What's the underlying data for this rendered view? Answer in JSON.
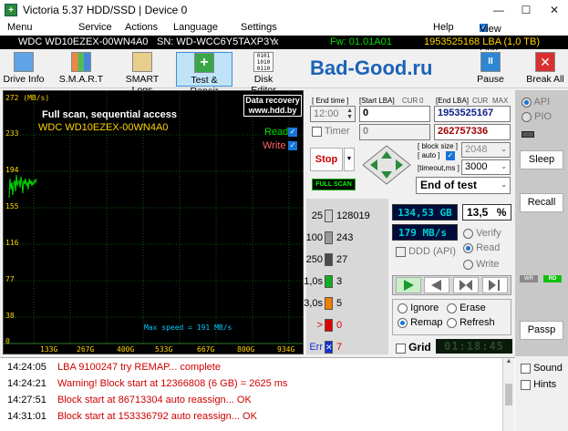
{
  "window": {
    "title": "Victoria 5.37 HDD/SSD | Device 0"
  },
  "menu": [
    "Menu",
    "Service",
    "Actions",
    "Language",
    "Settings",
    "Help",
    "View Buffer Live"
  ],
  "device_bar": {
    "model": "WDC WD10EZEX-00WN4A0",
    "serial": "SN: WD-WCC6Y5TAXP3Y",
    "close": "x",
    "fw": "Fw: 01.01A01",
    "lba": "1953525168 LBA (1,0 TB)"
  },
  "toolbar": {
    "items": [
      "Drive Info",
      "S.M.A.R.T",
      "SMART Logs",
      "Test & Repair",
      "Disk Editor"
    ],
    "brand": "Bad-Good.ru",
    "pause": "Pause",
    "break": "Break All"
  },
  "graph": {
    "ylabel_top": "272 (MB/s)",
    "y_ticks": [
      "233",
      "194",
      "155",
      "116",
      "77",
      "38",
      "0"
    ],
    "x_ticks": [
      "133G",
      "267G",
      "400G",
      "533G",
      "667G",
      "800G",
      "934G"
    ],
    "title": "Full scan, sequential access",
    "model": "WDC WD10EZEX-00WN4A0",
    "badge_line1": "Data recovery",
    "badge_line2": "www.hdd.by",
    "read": "Read",
    "write": "Write",
    "max_speed": "Max speed = 191 MB/s"
  },
  "controls": {
    "end_time_label": "[ End time ]",
    "start_lba_label": "[Start LBA]",
    "cur1": "CUR",
    "zero1": "0",
    "end_lba_label": "[End LBA]",
    "cur2": "CUR",
    "max": "MAX",
    "time": "12:00",
    "start_lba": "0",
    "end_lba": "1953525167",
    "timer": "Timer",
    "timer_val": "0",
    "cur_lba": "262757336",
    "stop": "Stop",
    "block_size_label": "[ block size ]",
    "auto_label": "[ auto ]",
    "block_size": "2048",
    "timeout_label": "[timeout,ms ]",
    "timeout": "3000",
    "full_scan": "FULL SCAN",
    "end_of_test": "End of test"
  },
  "counters": [
    {
      "label": "25",
      "value": "128019",
      "color": "#cfcfcf"
    },
    {
      "label": "100",
      "value": "243",
      "color": "#9a9a9a"
    },
    {
      "label": "250",
      "value": "27",
      "color": "#4a4a4a"
    },
    {
      "label": "1,0s",
      "value": "3",
      "color": "#10b020"
    },
    {
      "label": "3,0s",
      "value": "5",
      "color": "#f08000"
    },
    {
      "label": ">",
      "value": "0",
      "color": "#e00000"
    },
    {
      "label": "Err",
      "value": "7",
      "color": "#1030d0"
    }
  ],
  "stats": {
    "gb": "134,53 GB",
    "percent": "13,5",
    "percent_sign": "%",
    "speed": "179 MB/s",
    "ddd": "DDD (API)",
    "verify": "Verify",
    "read": "Read",
    "write": "Write"
  },
  "actions": {
    "ignore": "Ignore",
    "erase": "Erase",
    "remap": "Remap",
    "refresh": "Refresh",
    "grid": "Grid",
    "clock": "01:18:45"
  },
  "side": {
    "api": "API",
    "pio": "PIO",
    "sleep": "Sleep",
    "recall": "Recall",
    "wr": "WR",
    "rd": "RD",
    "passp": "Passp",
    "sound": "Sound",
    "hints": "Hints"
  },
  "log": [
    {
      "time": "14:24:05",
      "msg": "LBA 9100247 try REMAP... complete",
      "color": "#d00000"
    },
    {
      "time": "14:24:21",
      "msg": "Warning! Block start at 12366808 (6 GB)  = 2625 ms",
      "color": "#d00000"
    },
    {
      "time": "14:27:51",
      "msg": "Block start at 86713304 auto reassign... OK",
      "color": "#d00000"
    },
    {
      "time": "14:31:01",
      "msg": "Block start at 153336792 auto reassign... OK",
      "color": "#d00000"
    }
  ]
}
